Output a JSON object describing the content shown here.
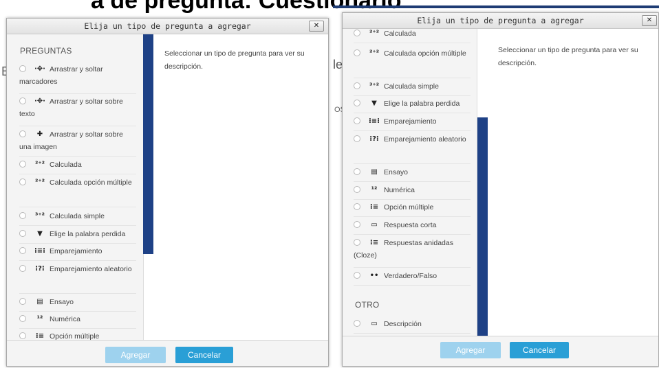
{
  "background": {
    "page_title_fragment": "a de pregunta: Cuestionario",
    "fragments": [
      "E",
      "le",
      "OS",
      "os",
      "a",
      "e"
    ]
  },
  "dialog": {
    "title": "Elija un tipo de pregunta a agregar",
    "close_label": "✕",
    "description": "Seleccionar un tipo de pregunta para ver su descripción.",
    "add_button": "Agregar",
    "cancel_button": "Cancelar"
  },
  "sections": {
    "questions": "PREGUNTAS",
    "other": "OTRO"
  },
  "left_list": [
    {
      "label": "Arrastrar y soltar marcadores",
      "icon": "drag-marker-icon",
      "glyph": "·✥·"
    },
    {
      "label": "Arrastrar y soltar sobre texto",
      "icon": "drag-text-icon",
      "glyph": "·✥·"
    },
    {
      "label": "Arrastrar y soltar sobre una imagen",
      "icon": "drag-image-icon",
      "glyph": "✚"
    },
    {
      "label": "Calculada",
      "icon": "calculated-icon",
      "glyph": "²⁺²"
    },
    {
      "label": "Calculada opción múltiple",
      "icon": "calculated-multi-icon",
      "glyph": "²⁺²"
    },
    {
      "label": "Calculada simple",
      "icon": "calculated-simple-icon",
      "glyph": "³⁺²"
    },
    {
      "label": "Elige la palabra perdida",
      "icon": "caret-down-icon",
      "glyph": "▼"
    },
    {
      "label": "Emparejamiento",
      "icon": "matching-icon",
      "glyph": "⁝≡⁝"
    },
    {
      "label": "Emparejamiento aleatorio",
      "icon": "random-matching-icon",
      "glyph": "⁝?⁝"
    },
    {
      "label": "Ensayo",
      "icon": "essay-icon",
      "glyph": "▤"
    },
    {
      "label": "Numérica",
      "icon": "numerical-icon",
      "glyph": "¹²"
    },
    {
      "label": "Opción múltiple",
      "icon": "multichoice-icon",
      "glyph": "⁝≡"
    }
  ],
  "right_list": [
    {
      "label": "Calculada",
      "icon": "calculated-icon",
      "glyph": "²⁺²"
    },
    {
      "label": "Calculada opción múltiple",
      "icon": "calculated-multi-icon",
      "glyph": "²⁺²"
    },
    {
      "label": "Calculada simple",
      "icon": "calculated-simple-icon",
      "glyph": "³⁺²"
    },
    {
      "label": "Elige la palabra perdida",
      "icon": "caret-down-icon",
      "glyph": "▼"
    },
    {
      "label": "Emparejamiento",
      "icon": "matching-icon",
      "glyph": "⁝≡⁝"
    },
    {
      "label": "Emparejamiento aleatorio",
      "icon": "random-matching-icon",
      "glyph": "⁝?⁝"
    },
    {
      "label": "Ensayo",
      "icon": "essay-icon",
      "glyph": "▤"
    },
    {
      "label": "Numérica",
      "icon": "numerical-icon",
      "glyph": "¹²"
    },
    {
      "label": "Opción múltiple",
      "icon": "multichoice-icon",
      "glyph": "⁝≡"
    },
    {
      "label": "Respuesta corta",
      "icon": "short-answer-icon",
      "glyph": "▭"
    },
    {
      "label": "Respuestas anidadas (Cloze)",
      "icon": "cloze-icon",
      "glyph": "⁝≡"
    },
    {
      "label": "Verdadero/Falso",
      "icon": "truefalse-icon",
      "glyph": "••"
    },
    {
      "label": "Descripción",
      "icon": "description-icon",
      "glyph": "▭"
    }
  ],
  "colors": {
    "accent_bar": "#1e4186",
    "add_button": "#9ed2ee",
    "cancel_button": "#2a9fd6"
  }
}
